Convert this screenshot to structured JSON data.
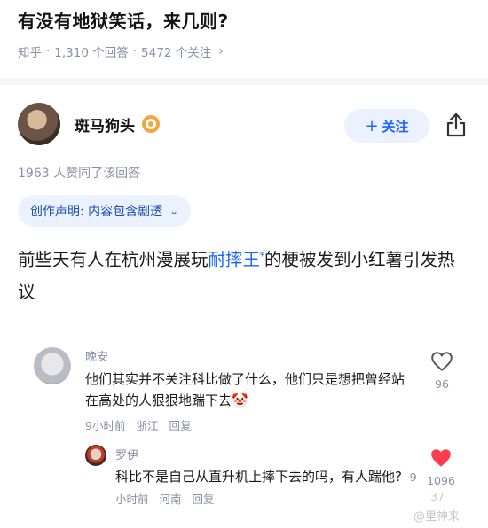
{
  "question": {
    "title": "有没有地狱笑话，来几则?",
    "source": "知乎",
    "answers": "1,310 个回答",
    "followers": "5472 个关注",
    "chevron": "›"
  },
  "author": {
    "name": "斑马狗头",
    "follow_label": "关注",
    "follow_plus": "+"
  },
  "answer": {
    "upvote_text": "1963 人赞同了该回答",
    "claim_text": "创作声明: 内容包含剧透",
    "claim_chevron": "⌄",
    "content_before": "前些天有人在杭州漫展玩",
    "content_link": "耐摔王",
    "content_search_mark": "ᵠ",
    "content_after": "的梗被发到小红薯引发热议"
  },
  "comments": [
    {
      "name": "晚安",
      "text": "他们其实并不关注科比做了什么，他们只是想把曾经站在高处的人狠狠地踹下去🤡",
      "time": "9小时前",
      "location": "浙江",
      "reply_label": "回复",
      "likes": "96"
    },
    {
      "name": "罗伊",
      "text": "科比不是自己从直升机上摔下去的吗，有人踹他?",
      "time": "9小时前",
      "location": "河南",
      "reply_label": "回复",
      "likes": "1096",
      "extra_count": "37"
    }
  ],
  "watermark": "@里神来",
  "colors": {
    "accent": "#1a66ff",
    "like_red": "#ff3b4e",
    "meta_gray": "#8590a6"
  }
}
